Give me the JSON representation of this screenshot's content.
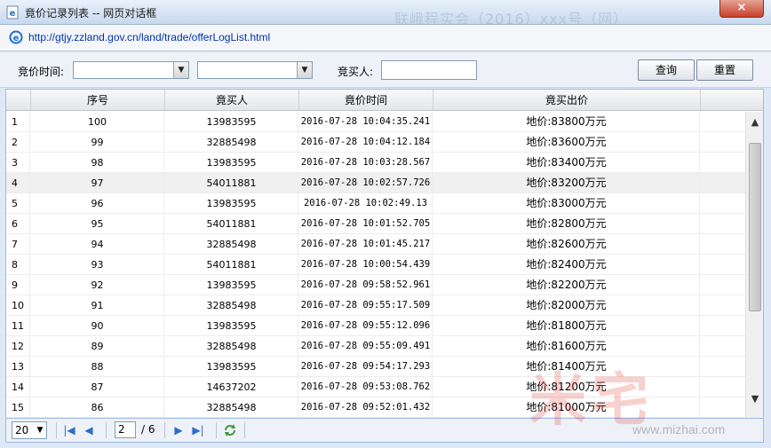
{
  "window": {
    "title": "竟价记录列表 -- 网页对话框",
    "background_text": "联峨程实会（2016）xxx号（网）",
    "close_label": "×"
  },
  "address": {
    "url": "http://gtjy.zzland.gov.cn/land/trade/offerLogList.html"
  },
  "filters": {
    "time_label": "竞价时间:",
    "time_start_value": "",
    "time_end_value": "",
    "buyer_label": "竞买人:",
    "buyer_value": "",
    "query_label": "查询",
    "reset_label": "重置"
  },
  "table": {
    "columns": [
      "",
      "序号",
      "竟买人",
      "竟价时间",
      "竟买出价"
    ],
    "rows": [
      [
        "1",
        "100",
        "13983595",
        "2016-07-28 10:04:35.241",
        "地价:83800万元"
      ],
      [
        "2",
        "99",
        "32885498",
        "2016-07-28 10:04:12.184",
        "地价:83600万元"
      ],
      [
        "3",
        "98",
        "13983595",
        "2016-07-28 10:03:28.567",
        "地价:83400万元"
      ],
      [
        "4",
        "97",
        "54011881",
        "2016-07-28 10:02:57.726",
        "地价:83200万元"
      ],
      [
        "5",
        "96",
        "13983595",
        "2016-07-28 10:02:49.13",
        "地价:83000万元"
      ],
      [
        "6",
        "95",
        "54011881",
        "2016-07-28 10:01:52.705",
        "地价:82800万元"
      ],
      [
        "7",
        "94",
        "32885498",
        "2016-07-28 10:01:45.217",
        "地价:82600万元"
      ],
      [
        "8",
        "93",
        "54011881",
        "2016-07-28 10:00:54.439",
        "地价:82400万元"
      ],
      [
        "9",
        "92",
        "13983595",
        "2016-07-28 09:58:52.961",
        "地价:82200万元"
      ],
      [
        "10",
        "91",
        "32885498",
        "2016-07-28 09:55:17.509",
        "地价:82000万元"
      ],
      [
        "11",
        "90",
        "13983595",
        "2016-07-28 09:55:12.096",
        "地价:81800万元"
      ],
      [
        "12",
        "89",
        "32885498",
        "2016-07-28 09:55:09.491",
        "地价:81600万元"
      ],
      [
        "13",
        "88",
        "13983595",
        "2016-07-28 09:54:17.293",
        "地价:81400万元"
      ],
      [
        "14",
        "87",
        "14637202",
        "2016-07-28 09:53:08.762",
        "地价:81200万元"
      ],
      [
        "15",
        "86",
        "32885498",
        "2016-07-28 09:52:01.432",
        "地价:81000万元"
      ]
    ]
  },
  "pager": {
    "page_size": "20",
    "current_page": "2",
    "total_pages": "/ 6"
  },
  "watermark": {
    "text": "米宅",
    "url": "www.mizhai.com"
  },
  "colors": {
    "accent": "#2f6fc4",
    "close": "#c8402b",
    "header_border": "#99bbe8"
  }
}
